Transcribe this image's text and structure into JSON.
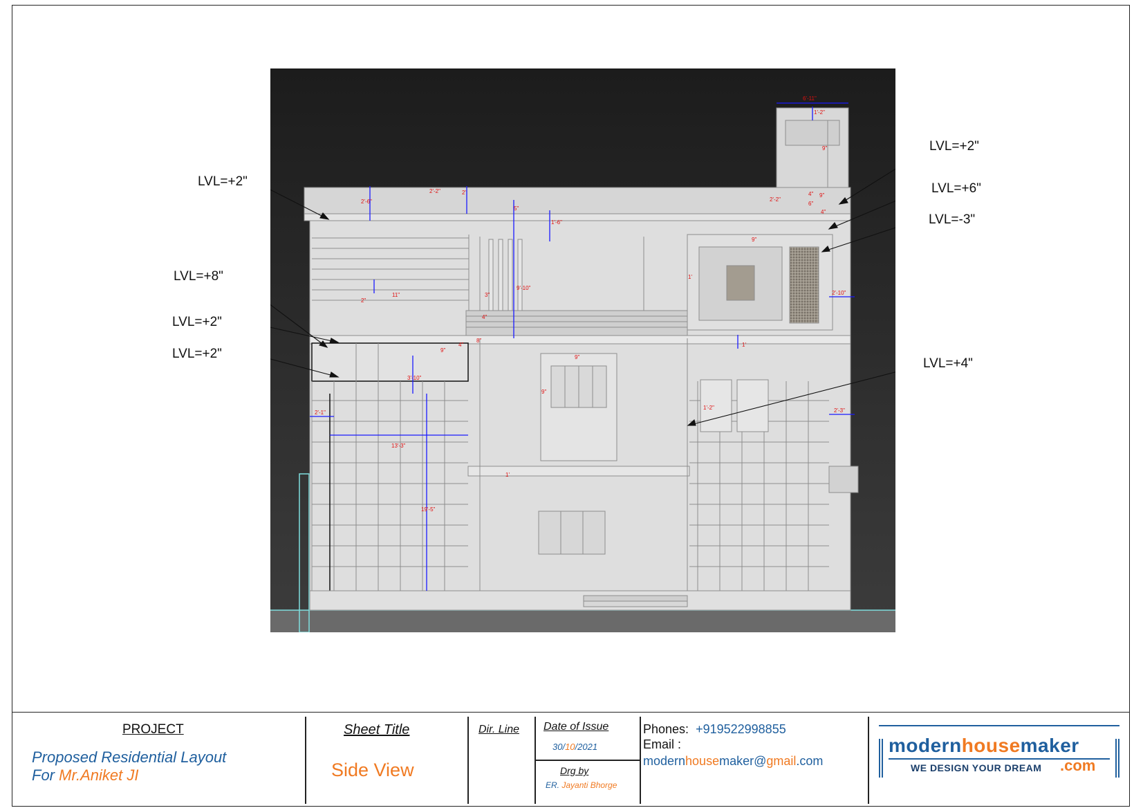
{
  "levels": [
    {
      "id": "lvl-left-1",
      "text": "LVL=+2\""
    },
    {
      "id": "lvl-left-2",
      "text": "LVL=+8\""
    },
    {
      "id": "lvl-left-3",
      "text": "LVL=+2\""
    },
    {
      "id": "lvl-left-4",
      "text": "LVL=+2\""
    },
    {
      "id": "lvl-right-1",
      "text": "LVL=+2\""
    },
    {
      "id": "lvl-right-2",
      "text": "LVL=+6\""
    },
    {
      "id": "lvl-right-3",
      "text": "LVL=-3\""
    },
    {
      "id": "lvl-right-4",
      "text": "LVL=+4\""
    }
  ],
  "dimensions": [
    "6'-11\"",
    "1'-2\"",
    "9\"",
    "2'-6\"",
    "2'-2\"",
    "2'",
    "5\"",
    "1'-6\"",
    "9\"",
    "1'",
    "2'-10\"",
    "11\"",
    "2\"",
    "3\"",
    "4\"",
    "9'-10\"",
    "8\"",
    "4\"",
    "9\"",
    "1'",
    "3'-10\"",
    "9\"",
    "9\"",
    "1'-2\"",
    "2'-3\"",
    "2'-1\"",
    "13'-3\"",
    "1'",
    "19'-5\"",
    "2'-2\"",
    "4\"",
    "9\"",
    "6\"",
    "4\""
  ],
  "title_block": {
    "project_heading": "PROJECT",
    "project_line1": "Proposed Residential Layout",
    "project_for": "For ",
    "project_client": "Mr.Aniket JI",
    "sheet_title_heading": "Sheet Title",
    "sheet_title_value": "Side View",
    "dir_line_heading": "Dir. Line",
    "date_heading": "Date of Issue",
    "date_day": "30/",
    "date_month": "10",
    "date_year": "/2021",
    "drg_heading": "Drg by",
    "drg_prefix": "ER. ",
    "drg_name": "Jayanti Bhorge",
    "phones_label": "Phones:",
    "phones_value": "+919522998855",
    "email_label": "Email :",
    "email_p1": "modern",
    "email_p2": "house",
    "email_p3": "maker@",
    "email_p4": "gmail",
    "email_p5": ".com"
  },
  "logo": {
    "modern": "modern",
    "house": "house",
    "maker": "maker",
    "tagline": "WE DESIGN YOUR DREAM",
    "dotcom": ".com"
  },
  "colors": {
    "accent_blue": "#1f5f9e",
    "accent_orange": "#f07a22",
    "dimension_red": "#e01010",
    "dimension_line": "#1a1aff"
  }
}
